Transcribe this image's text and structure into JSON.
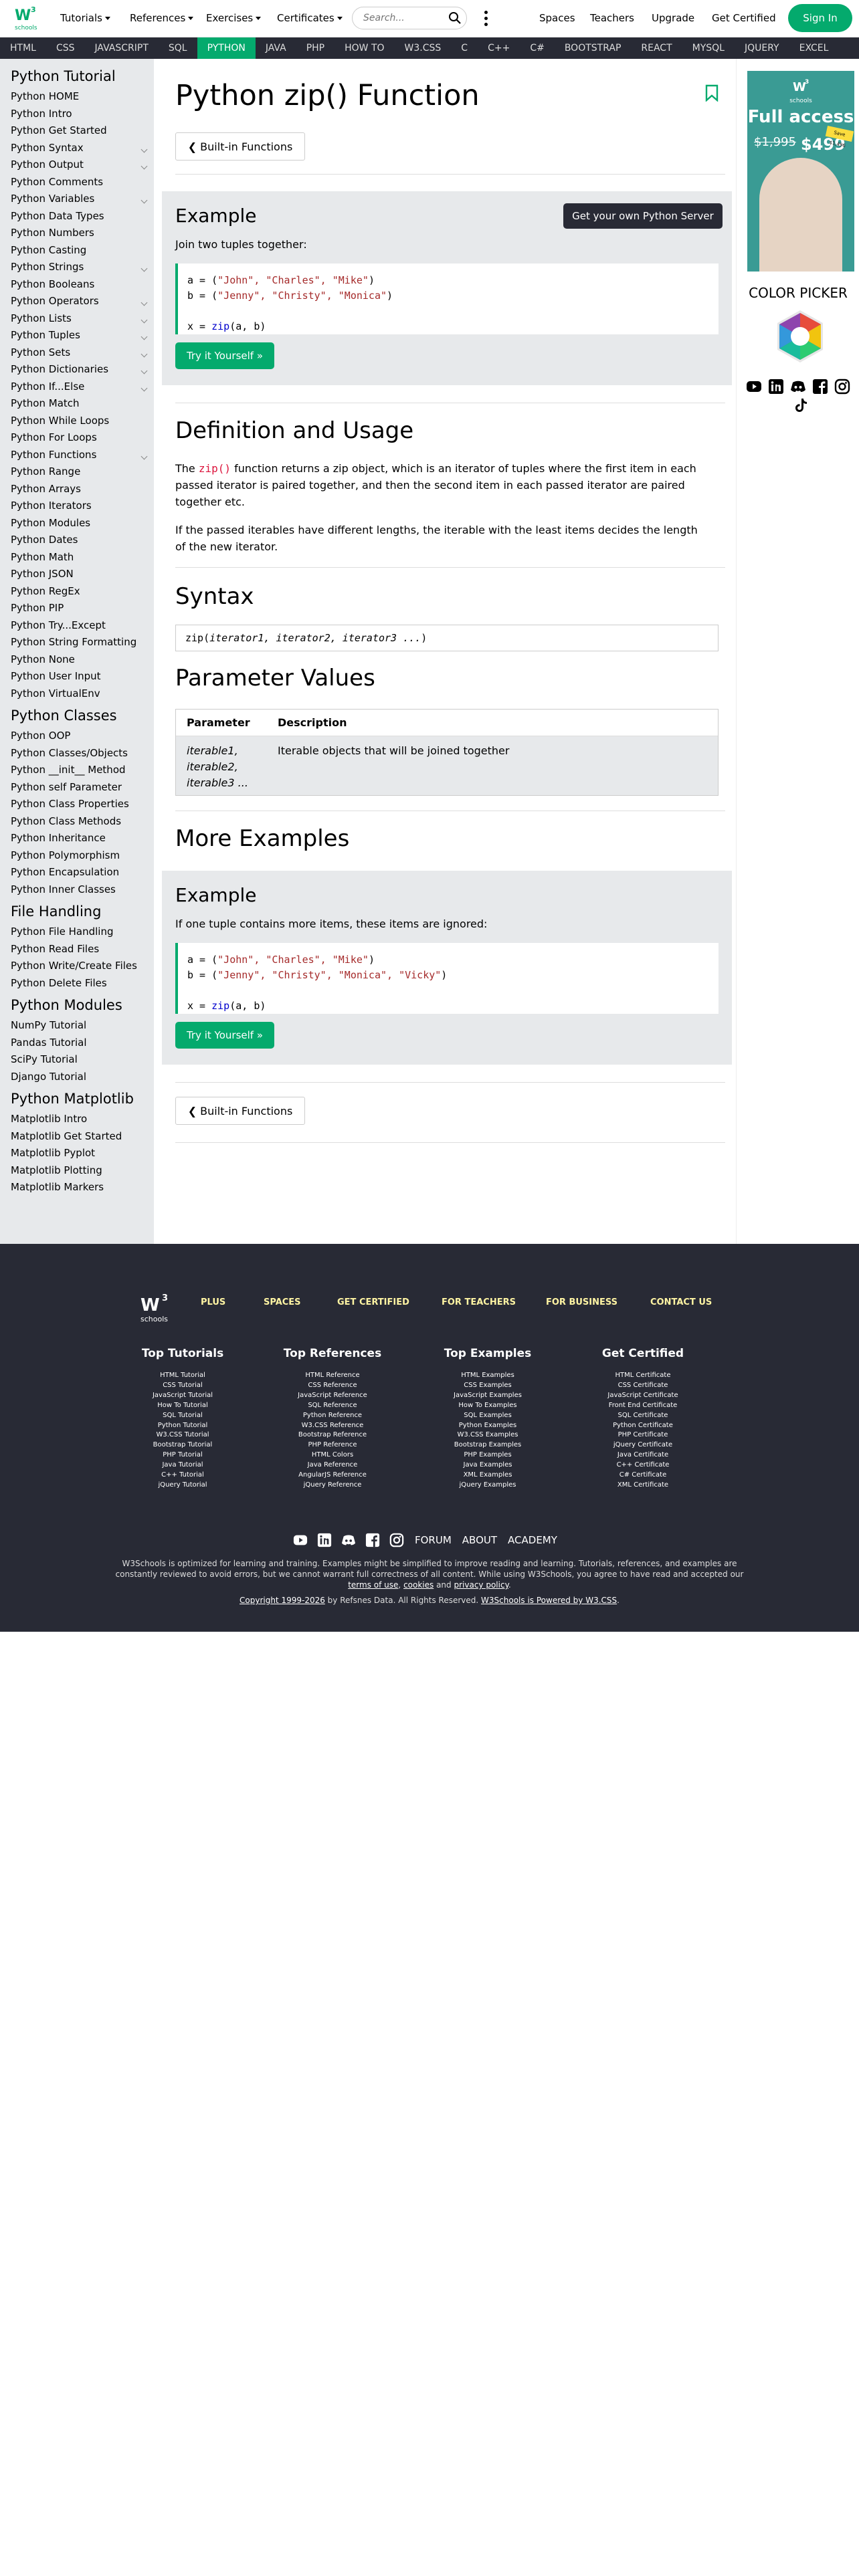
{
  "topbar": {
    "logo_text": "W3",
    "logo_sub": "schools",
    "menu": [
      "Tutorials",
      "References",
      "Exercises",
      "Certificates"
    ],
    "search_placeholder": "Search...",
    "right": [
      "Spaces",
      "Teachers",
      "Upgrade",
      "Get Certified"
    ],
    "signin": "Sign In"
  },
  "langnav": [
    "HTML",
    "CSS",
    "JAVASCRIPT",
    "SQL",
    "PYTHON",
    "JAVA",
    "PHP",
    "HOW TO",
    "W3.CSS",
    "C",
    "C++",
    "C#",
    "BOOTSTRAP",
    "REACT",
    "MYSQL",
    "JQUERY",
    "EXCEL"
  ],
  "sidebar": {
    "sections": [
      {
        "title": "Python Tutorial",
        "items": [
          {
            "label": "Python HOME"
          },
          {
            "label": "Python Intro"
          },
          {
            "label": "Python Get Started"
          },
          {
            "label": "Python Syntax",
            "expand": true
          },
          {
            "label": "Python Output",
            "expand": true
          },
          {
            "label": "Python Comments"
          },
          {
            "label": "Python Variables",
            "expand": true
          },
          {
            "label": "Python Data Types"
          },
          {
            "label": "Python Numbers"
          },
          {
            "label": "Python Casting"
          },
          {
            "label": "Python Strings",
            "expand": true
          },
          {
            "label": "Python Booleans"
          },
          {
            "label": "Python Operators",
            "expand": true
          },
          {
            "label": "Python Lists",
            "expand": true
          },
          {
            "label": "Python Tuples",
            "expand": true
          },
          {
            "label": "Python Sets",
            "expand": true
          },
          {
            "label": "Python Dictionaries",
            "expand": true
          },
          {
            "label": "Python If...Else",
            "expand": true
          },
          {
            "label": "Python Match"
          },
          {
            "label": "Python While Loops"
          },
          {
            "label": "Python For Loops"
          },
          {
            "label": "Python Functions",
            "expand": true
          },
          {
            "label": "Python Range"
          },
          {
            "label": "Python Arrays"
          },
          {
            "label": "Python Iterators"
          },
          {
            "label": "Python Modules"
          },
          {
            "label": "Python Dates"
          },
          {
            "label": "Python Math"
          },
          {
            "label": "Python JSON"
          },
          {
            "label": "Python RegEx"
          },
          {
            "label": "Python PIP"
          },
          {
            "label": "Python Try...Except"
          },
          {
            "label": "Python String Formatting"
          },
          {
            "label": "Python None"
          },
          {
            "label": "Python User Input"
          },
          {
            "label": "Python VirtualEnv"
          }
        ]
      },
      {
        "title": "Python Classes",
        "items": [
          {
            "label": "Python OOP"
          },
          {
            "label": "Python Classes/Objects"
          },
          {
            "label": "Python __init__ Method"
          },
          {
            "label": "Python self Parameter"
          },
          {
            "label": "Python Class Properties"
          },
          {
            "label": "Python Class Methods"
          },
          {
            "label": "Python Inheritance"
          },
          {
            "label": "Python Polymorphism"
          },
          {
            "label": "Python Encapsulation"
          },
          {
            "label": "Python Inner Classes"
          }
        ]
      },
      {
        "title": "File Handling",
        "items": [
          {
            "label": "Python File Handling"
          },
          {
            "label": "Python Read Files"
          },
          {
            "label": "Python Write/Create Files"
          },
          {
            "label": "Python Delete Files"
          }
        ]
      },
      {
        "title": "Python Modules",
        "items": [
          {
            "label": "NumPy Tutorial"
          },
          {
            "label": "Pandas Tutorial"
          },
          {
            "label": "SciPy Tutorial"
          },
          {
            "label": "Django Tutorial"
          }
        ]
      },
      {
        "title": "Python Matplotlib",
        "items": [
          {
            "label": "Matplotlib Intro"
          },
          {
            "label": "Matplotlib Get Started"
          },
          {
            "label": "Matplotlib Pyplot"
          },
          {
            "label": "Matplotlib Plotting"
          },
          {
            "label": "Matplotlib Markers"
          }
        ]
      }
    ]
  },
  "main": {
    "title": "Python zip() Function",
    "back_label": "❮ Built-in Functions",
    "example1": {
      "heading": "Example",
      "server_btn": "Get your own Python Server",
      "desc": "Join two tuples together:",
      "code": {
        "a_prefix": "a = (",
        "a_vals": "\"John\", \"Charles\", \"Mike\"",
        "b_prefix": "b = (",
        "b_vals": "\"Jenny\", \"Christy\", \"Monica\"",
        "close": ")",
        "x_prefix": "x = ",
        "zip": "zip",
        "x_args": "(a, b)"
      },
      "try_btn": "Try it Yourself »"
    },
    "definition": {
      "heading": "Definition and Usage",
      "p1_pre": "The ",
      "p1_code": "zip()",
      "p1_post": " function returns a zip object, which is an iterator of tuples where the first item in each passed iterator is paired together, and then the second item in each passed iterator are paired together etc.",
      "p2": "If the passed iterables have different lengths, the iterable with the least items decides the length of the new iterator."
    },
    "syntax": {
      "heading": "Syntax",
      "fn": "zip(",
      "args": "iterator1, iterator2, iterator3 ...",
      "close": ")"
    },
    "params": {
      "heading": "Parameter Values",
      "col1": "Parameter",
      "col2": "Description",
      "names": [
        "iterable1,",
        "iterable2,",
        "iterable3 ..."
      ],
      "desc": "Iterable objects that will be joined together"
    },
    "more": {
      "heading": "More Examples"
    },
    "example2": {
      "heading": "Example",
      "desc": "If one tuple contains more items, these items are ignored:",
      "code": {
        "a_prefix": "a = (",
        "a_vals": "\"John\", \"Charles\", \"Mike\"",
        "b_prefix": "b = (",
        "b_vals": "\"Jenny\", \"Christy\", \"Monica\", \"Vicky\"",
        "close": ")",
        "x_prefix": "x = ",
        "zip": "zip",
        "x_args": "(a, b)"
      },
      "try_btn": "Try it Yourself »"
    }
  },
  "ad": {
    "sub": "schools",
    "title": "Full access",
    "old_price": "$1,995",
    "new_price": "$499",
    "badge": "Save $1,496"
  },
  "color_picker": "COLOR PICKER",
  "footer": {
    "nav": [
      "PLUS",
      "SPACES",
      "GET CERTIFIED",
      "FOR TEACHERS",
      "FOR BUSINESS",
      "CONTACT US"
    ],
    "columns": [
      {
        "title": "Top Tutorials",
        "items": [
          "HTML Tutorial",
          "CSS Tutorial",
          "JavaScript Tutorial",
          "How To Tutorial",
          "SQL Tutorial",
          "Python Tutorial",
          "W3.CSS Tutorial",
          "Bootstrap Tutorial",
          "PHP Tutorial",
          "Java Tutorial",
          "C++ Tutorial",
          "jQuery Tutorial"
        ]
      },
      {
        "title": "Top References",
        "items": [
          "HTML Reference",
          "CSS Reference",
          "JavaScript Reference",
          "SQL Reference",
          "Python Reference",
          "W3.CSS Reference",
          "Bootstrap Reference",
          "PHP Reference",
          "HTML Colors",
          "Java Reference",
          "AngularJS Reference",
          "jQuery Reference"
        ]
      },
      {
        "title": "Top Examples",
        "items": [
          "HTML Examples",
          "CSS Examples",
          "JavaScript Examples",
          "How To Examples",
          "SQL Examples",
          "Python Examples",
          "W3.CSS Examples",
          "Bootstrap Examples",
          "PHP Examples",
          "Java Examples",
          "XML Examples",
          "jQuery Examples"
        ]
      },
      {
        "title": "Get Certified",
        "items": [
          "HTML Certificate",
          "CSS Certificate",
          "JavaScript Certificate",
          "Front End Certificate",
          "SQL Certificate",
          "Python Certificate",
          "PHP Certificate",
          "jQuery Certificate",
          "Java Certificate",
          "C++ Certificate",
          "C# Certificate",
          "XML Certificate"
        ]
      }
    ],
    "links": [
      "FORUM",
      "ABOUT",
      "ACADEMY"
    ],
    "note1": "W3Schools is optimized for learning and training. Examples might be simplified to improve reading and learning. Tutorials, references, and examples are constantly reviewed to avoid errors, but we cannot warrant full correctness of all content. While using W3Schools, you agree to have read and accepted our",
    "terms": "terms of use",
    "comma": ",",
    "cookies": "cookies",
    "and": " and ",
    "privacy": "privacy policy",
    "period": ".",
    "copyright": "Copyright 1999-2026",
    "by": " by Refsnes Data. All Rights Reserved. ",
    "powered": "W3Schools is Powered by W3.CSS",
    "end": "."
  }
}
